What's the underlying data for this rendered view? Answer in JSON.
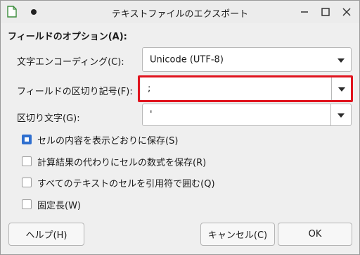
{
  "window": {
    "title": "テキストファイルのエクスポート"
  },
  "section_title": "フィールドのオプション(A):",
  "fields": {
    "charset": {
      "label": "文字エンコーディング(C):",
      "value": "Unicode (UTF-8)"
    },
    "field_delimiter": {
      "label": "フィールドの区切り記号(F):",
      "value": ";"
    },
    "string_delimiter": {
      "label": "区切り文字(G):",
      "value": "'"
    }
  },
  "options": [
    {
      "label": "セルの内容を表示どおりに保存(S)",
      "checked": true
    },
    {
      "label": "計算結果の代わりにセルの数式を保存(R)",
      "checked": false
    },
    {
      "label": "すべてのテキストのセルを引用符で囲む(Q)",
      "checked": false
    },
    {
      "label": "固定長(W)",
      "checked": false
    }
  ],
  "buttons": {
    "help": "ヘルプ(H)",
    "cancel": "キャンセル(C)",
    "ok": "OK"
  },
  "colors": {
    "highlight": "#e0141e",
    "accent": "#2f6fcf"
  }
}
